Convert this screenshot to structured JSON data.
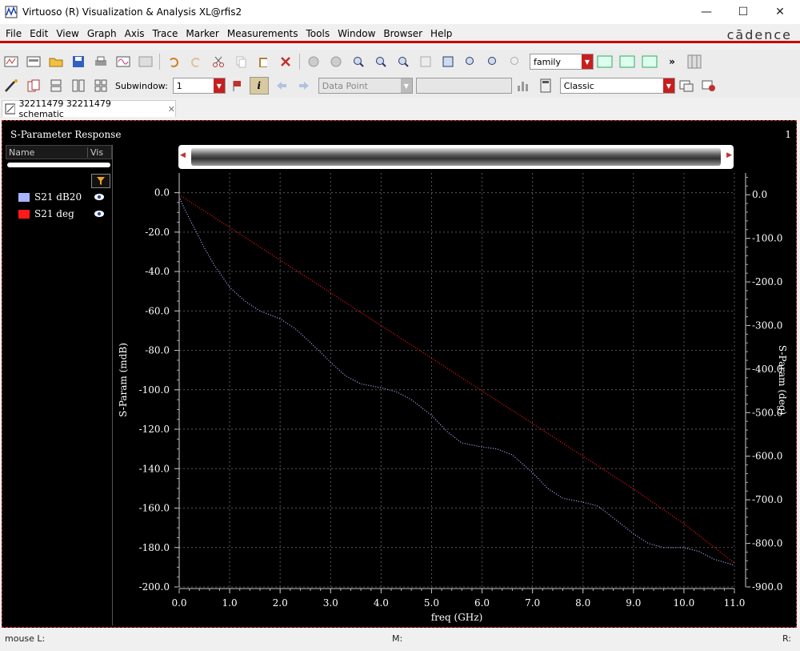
{
  "window": {
    "title": "Virtuoso (R) Visualization & Analysis XL@rfis2",
    "minimize": "—",
    "maximize": "☐",
    "close": "✕"
  },
  "menu": {
    "items": [
      "File",
      "Edit",
      "View",
      "Graph",
      "Axis",
      "Trace",
      "Marker",
      "Measurements",
      "Tools",
      "Window",
      "Browser",
      "Help"
    ],
    "brand": "cādence"
  },
  "toolbar1": {
    "family_combo": "family"
  },
  "toolbar2": {
    "subwindow_label": "Subwindow:",
    "subwindow_value": "1",
    "data_point_combo": "Data Point",
    "style_combo": "Classic"
  },
  "tab": {
    "label": "32211479 32211479 schematic",
    "close": "✕"
  },
  "plot": {
    "title": "S-Parameter Response",
    "subwindow_number": "1",
    "legend_header": {
      "name": "Name",
      "vis": "Vis"
    },
    "legend": [
      {
        "name": "S21 dB20",
        "color": "#a9b4ff"
      },
      {
        "name": "S21 deg",
        "color": "#ff1a1a"
      }
    ]
  },
  "status": {
    "mouse_left": "mouse L:",
    "mouse_mid": "M:",
    "mouse_right": "R:"
  },
  "chart_data": {
    "type": "line",
    "xlabel": "freq (GHz)",
    "ylabel_left": "S-Param (mdB)",
    "ylabel_right": "S-Param (deg)",
    "xlim": [
      0,
      11
    ],
    "ylim_left": [
      -200,
      10
    ],
    "ylim_right": [
      -900,
      50
    ],
    "x_ticks": [
      "0.0",
      "1.0",
      "2.0",
      "3.0",
      "4.0",
      "5.0",
      "6.0",
      "7.0",
      "8.0",
      "9.0",
      "10.0",
      "11.0"
    ],
    "y_left_ticks": [
      "0.0",
      "-20.0",
      "-40.0",
      "-60.0",
      "-80.0",
      "-100.0",
      "-120.0",
      "-140.0",
      "-160.0",
      "-180.0",
      "-200.0"
    ],
    "y_right_ticks": [
      "0.0",
      "-100.0",
      "-200.0",
      "-300.0",
      "-400.0",
      "-500.0",
      "-600.0",
      "-700.0",
      "-800.0",
      "-900.0"
    ],
    "grid": true,
    "series": [
      {
        "name": "S21 dB20",
        "axis": "left",
        "color": "#a9b4ff",
        "x": [
          0.0,
          0.1,
          0.3,
          0.5,
          0.7,
          1.0,
          1.3,
          1.6,
          2.0,
          2.3,
          2.6,
          3.0,
          3.3,
          3.6,
          4.0,
          4.3,
          4.6,
          5.0,
          5.3,
          5.6,
          6.0,
          6.3,
          6.6,
          7.0,
          7.3,
          7.6,
          8.0,
          8.3,
          8.6,
          9.0,
          9.3,
          9.6,
          10.0,
          10.3,
          10.6,
          11.0
        ],
        "values": [
          -2,
          -8,
          -18,
          -28,
          -37,
          -48,
          -55,
          -60,
          -64,
          -69,
          -76,
          -86,
          -93,
          -97,
          -99,
          -101,
          -105,
          -113,
          -121,
          -127,
          -129,
          -130,
          -133,
          -142,
          -150,
          -155,
          -157,
          -159,
          -165,
          -173,
          -178,
          -180,
          -180,
          -182,
          -186,
          -189
        ]
      },
      {
        "name": "S21 deg",
        "axis": "right",
        "color": "#ff1a1a",
        "x": [
          0.0,
          1.0,
          2.0,
          3.0,
          4.0,
          5.0,
          6.0,
          7.0,
          8.0,
          9.0,
          10.0,
          11.0
        ],
        "values": [
          0,
          -75,
          -150,
          -225,
          -300,
          -375,
          -450,
          -525,
          -600,
          -675,
          -755,
          -845
        ]
      }
    ]
  }
}
